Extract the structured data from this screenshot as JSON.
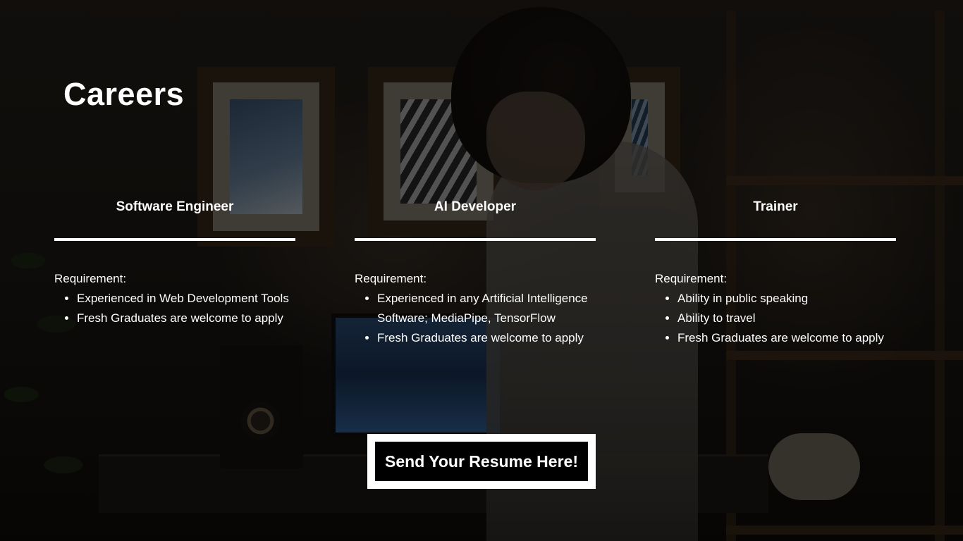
{
  "page": {
    "title": "Careers"
  },
  "jobs": [
    {
      "title": "Software Engineer",
      "requirement_label": "Requirement:",
      "requirements": [
        "Experienced in Web Development Tools",
        "Fresh Graduates are welcome to apply"
      ]
    },
    {
      "title": "AI Developer",
      "requirement_label": "Requirement:",
      "requirements": [
        "Experienced in any Artificial Intelligence Software; MediaPipe, TensorFlow",
        "Fresh Graduates are welcome to apply"
      ]
    },
    {
      "title": "Trainer",
      "requirement_label": "Requirement:",
      "requirements": [
        "Ability in public speaking",
        "Ability to travel",
        "Fresh Graduates are welcome to apply"
      ]
    }
  ],
  "cta": {
    "label": "Send Your Resume Here!"
  },
  "colors": {
    "text": "#ffffff",
    "overlay": "#000000",
    "button_border": "#ffffff",
    "button_fill": "#000000"
  }
}
